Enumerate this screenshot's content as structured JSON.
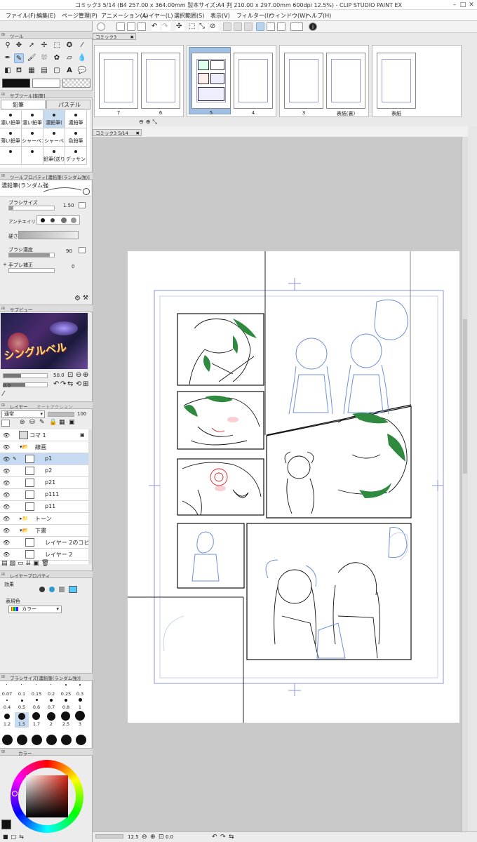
{
  "window": {
    "title": "コミック3 5/14 (B4 257.00 x 364.00mm 製本サイズ:A4 判 210.00 x 297.00mm 600dpi 12.5%) - CLIP STUDIO PAINT EX"
  },
  "menu": [
    "ファイル(F)",
    "編集(E)",
    "ページ管理(P)",
    "アニメーション(A)",
    "レイヤー(L)",
    "選択範囲(S)",
    "表示(V)",
    "フィルター(I)",
    "ウィンドウ(W)",
    "ヘルプ(H)"
  ],
  "tool_panel": {
    "title": "ツール"
  },
  "sub_tool_panel": {
    "title": "サブツール[鉛筆]",
    "tabs": [
      "鉛筆",
      "パステル"
    ],
    "brushes_row1": [
      "濃い鉛筆",
      "濃い鉛筆",
      "濃鉛筆(",
      "濃鉛筆"
    ],
    "brushes_row2": [
      "薄い鉛筆",
      "シャーペン",
      "シャーペ",
      "色鉛筆"
    ],
    "brushes_row3": [
      "",
      "",
      "鉛筆(送り",
      "デッサン"
    ]
  },
  "tool_property": {
    "title": "ツールプロパティ[濃鉛筆(ランダム強)]",
    "brush_name": "濃鉛筆(ランダム強",
    "brush_size_label": "ブラシサイズ",
    "brush_size_value": "1.50",
    "antialias_label": "アンチエイリアス",
    "hardness_label": "硬さ",
    "density_label": "ブラシ濃度",
    "density_value": "90",
    "stabilize_label": "手ブレ補正",
    "stabilize_value": "0"
  },
  "sub_view": {
    "title": "サブビュー",
    "thumb_text": "シングルベル",
    "zoom_value": "50.0",
    "angle_value": "0.0"
  },
  "layer_panel": {
    "tabs": [
      "レイヤー",
      "オートアクション"
    ],
    "blend_mode": "通常",
    "opacity": "100",
    "layers": [
      {
        "name": "コマ 1",
        "indent": 1
      },
      {
        "name": "線画",
        "indent": 1
      },
      {
        "name": "p1",
        "indent": 2
      },
      {
        "name": "p2",
        "indent": 2
      },
      {
        "name": "p21",
        "indent": 2
      },
      {
        "name": "p111",
        "indent": 2
      },
      {
        "name": "p11",
        "indent": 2
      },
      {
        "name": "トーン",
        "indent": 1
      },
      {
        "name": "下書",
        "indent": 1
      },
      {
        "name": "レイヤー 2のコピー",
        "indent": 2
      },
      {
        "name": "レイヤー 2",
        "indent": 2
      }
    ]
  },
  "layer_property": {
    "title": "レイヤープロパティ",
    "effect_label": "効果",
    "color_label": "表現色",
    "color_value": "カラー"
  },
  "brush_size_panel": {
    "title": "ブラシサイズ[濃鉛筆(ランダム強)]",
    "sizes": [
      "0.07",
      "0.1",
      "0.15",
      "0.2",
      "0.25",
      "0.3",
      "0.4",
      "0.5",
      "0.6",
      "0.7",
      "0.8",
      "1",
      "1.2",
      "1.5",
      "1.7",
      "2",
      "2.5",
      "3"
    ]
  },
  "color_panel": {
    "title": "カラー",
    "main_color": "#b22222"
  },
  "doc_tabs": {
    "strip": "コミック3",
    "canvas": "コミック3 5/14"
  },
  "pages": [
    {
      "label": "7"
    },
    {
      "label": "6"
    },
    {
      "label": "5"
    },
    {
      "label": "4"
    },
    {
      "label": "3"
    },
    {
      "label": "表紙(裏)"
    },
    {
      "label": "表紙"
    }
  ],
  "status": {
    "zoom": "12.5",
    "angle": "0.0"
  },
  "colors": {
    "accent": "#2f8a3f",
    "blue_sketch": "#6f90d8",
    "selected": "#c6dbf2"
  }
}
